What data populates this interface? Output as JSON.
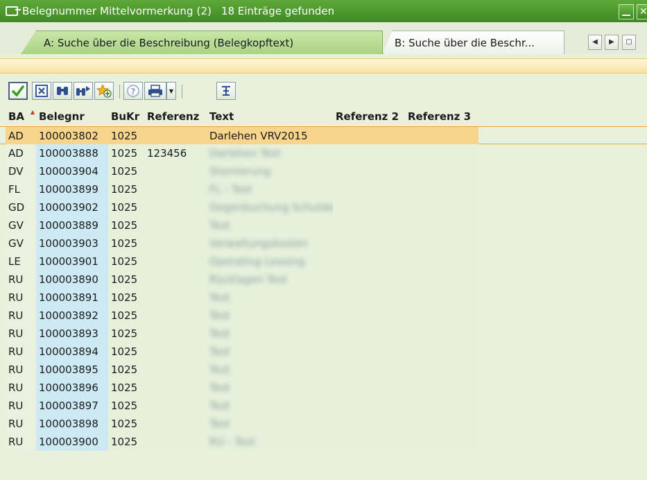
{
  "window": {
    "title": "Belegnummer Mittelvormerkung (2)",
    "count_text": "18 Einträge gefunden"
  },
  "tabs": [
    {
      "label": "A: Suche über die Beschreibung (Belegkopftext)",
      "active": true
    },
    {
      "label": "B: Suche über die Beschr...",
      "active": false
    }
  ],
  "toolbar": {
    "buttons": [
      "ok-icon",
      "cancel-icon",
      "find-icon",
      "find-next-icon",
      "add-favorite-icon",
      "info-icon",
      "print-icon",
      "sum-icon"
    ]
  },
  "table": {
    "columns": [
      "BA",
      "Belegnr",
      "BuKr",
      "Referenz",
      "Text",
      "Referenz 2",
      "Referenz 3"
    ],
    "rows": [
      {
        "ba": "AD",
        "belegnr": "100003802",
        "bukr": "1025",
        "ref": "",
        "text": "Darlehen VRV2015",
        "selected": true
      },
      {
        "ba": "AD",
        "belegnr": "100003888",
        "bukr": "1025",
        "ref": "123456",
        "text": "Darlehen Test"
      },
      {
        "ba": "DV",
        "belegnr": "100003904",
        "bukr": "1025",
        "ref": "",
        "text": "Stornierung"
      },
      {
        "ba": "FL",
        "belegnr": "100003899",
        "bukr": "1025",
        "ref": "",
        "text": "FL - Test"
      },
      {
        "ba": "GD",
        "belegnr": "100003902",
        "bukr": "1025",
        "ref": "",
        "text": "Gegenbuchung Schulden"
      },
      {
        "ba": "GV",
        "belegnr": "100003889",
        "bukr": "1025",
        "ref": "",
        "text": "Test"
      },
      {
        "ba": "GV",
        "belegnr": "100003903",
        "bukr": "1025",
        "ref": "",
        "text": "Verwaltungskosten"
      },
      {
        "ba": "LE",
        "belegnr": "100003901",
        "bukr": "1025",
        "ref": "",
        "text": "Operating Leasing"
      },
      {
        "ba": "RU",
        "belegnr": "100003890",
        "bukr": "1025",
        "ref": "",
        "text": "Rücklagen Test"
      },
      {
        "ba": "RU",
        "belegnr": "100003891",
        "bukr": "1025",
        "ref": "",
        "text": "Test"
      },
      {
        "ba": "RU",
        "belegnr": "100003892",
        "bukr": "1025",
        "ref": "",
        "text": "Test"
      },
      {
        "ba": "RU",
        "belegnr": "100003893",
        "bukr": "1025",
        "ref": "",
        "text": "Test"
      },
      {
        "ba": "RU",
        "belegnr": "100003894",
        "bukr": "1025",
        "ref": "",
        "text": "Test"
      },
      {
        "ba": "RU",
        "belegnr": "100003895",
        "bukr": "1025",
        "ref": "",
        "text": "Test"
      },
      {
        "ba": "RU",
        "belegnr": "100003896",
        "bukr": "1025",
        "ref": "",
        "text": "Test"
      },
      {
        "ba": "RU",
        "belegnr": "100003897",
        "bukr": "1025",
        "ref": "",
        "text": "Test"
      },
      {
        "ba": "RU",
        "belegnr": "100003898",
        "bukr": "1025",
        "ref": "",
        "text": "Test"
      },
      {
        "ba": "RU",
        "belegnr": "100003900",
        "bukr": "1025",
        "ref": "",
        "text": "RU - Test"
      }
    ]
  },
  "colors": {
    "titlebar": "#4a9a2c",
    "selected_row": "#f8d58d",
    "key_column": "#cdeaf4",
    "background": "#e9f0dc"
  }
}
